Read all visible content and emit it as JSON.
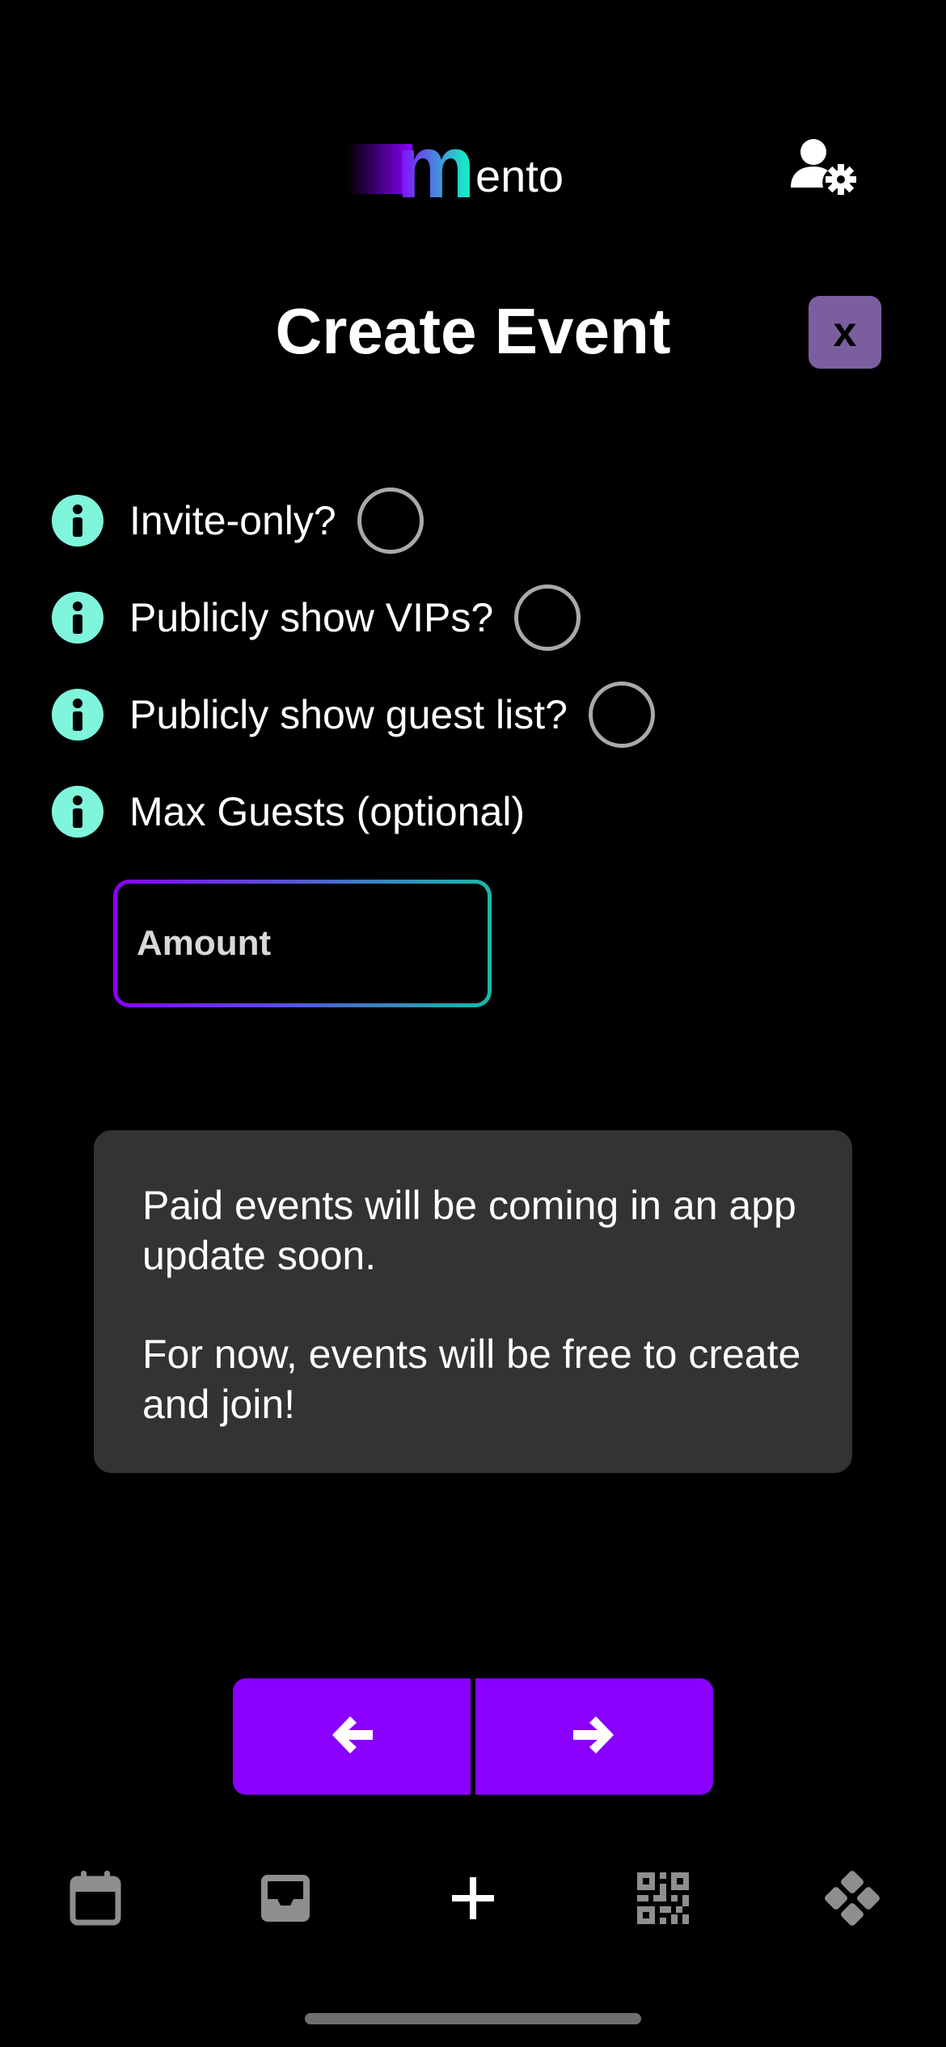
{
  "header": {
    "logo_rest": "ento",
    "logo_m": "m"
  },
  "page": {
    "title": "Create Event",
    "close_label": "x"
  },
  "options": [
    {
      "label": "Invite-only?",
      "checked": false
    },
    {
      "label": "Publicly show VIPs?",
      "checked": false
    },
    {
      "label": "Publicly show guest list?",
      "checked": false
    }
  ],
  "max_guests": {
    "label": "Max Guests (optional)",
    "placeholder": "Amount",
    "value": ""
  },
  "notice": {
    "line1": "Paid events will be coming in an app update soon.",
    "line2": "For now, events will be free to create and join!"
  },
  "navigation": {
    "prev_icon": "arrow-left-icon",
    "next_icon": "arrow-right-icon"
  },
  "tabbar": {
    "items": [
      "calendar-icon",
      "inbox-icon",
      "plus-icon",
      "qr-code-icon",
      "diamond-grid-icon"
    ],
    "active": "plus-icon"
  },
  "colors": {
    "accent": "#8a00ff",
    "teal": "#7ff5dc",
    "close_bg": "#7b5ea0",
    "notice_bg": "#333333",
    "inactive_icon": "#8e8e8e"
  }
}
